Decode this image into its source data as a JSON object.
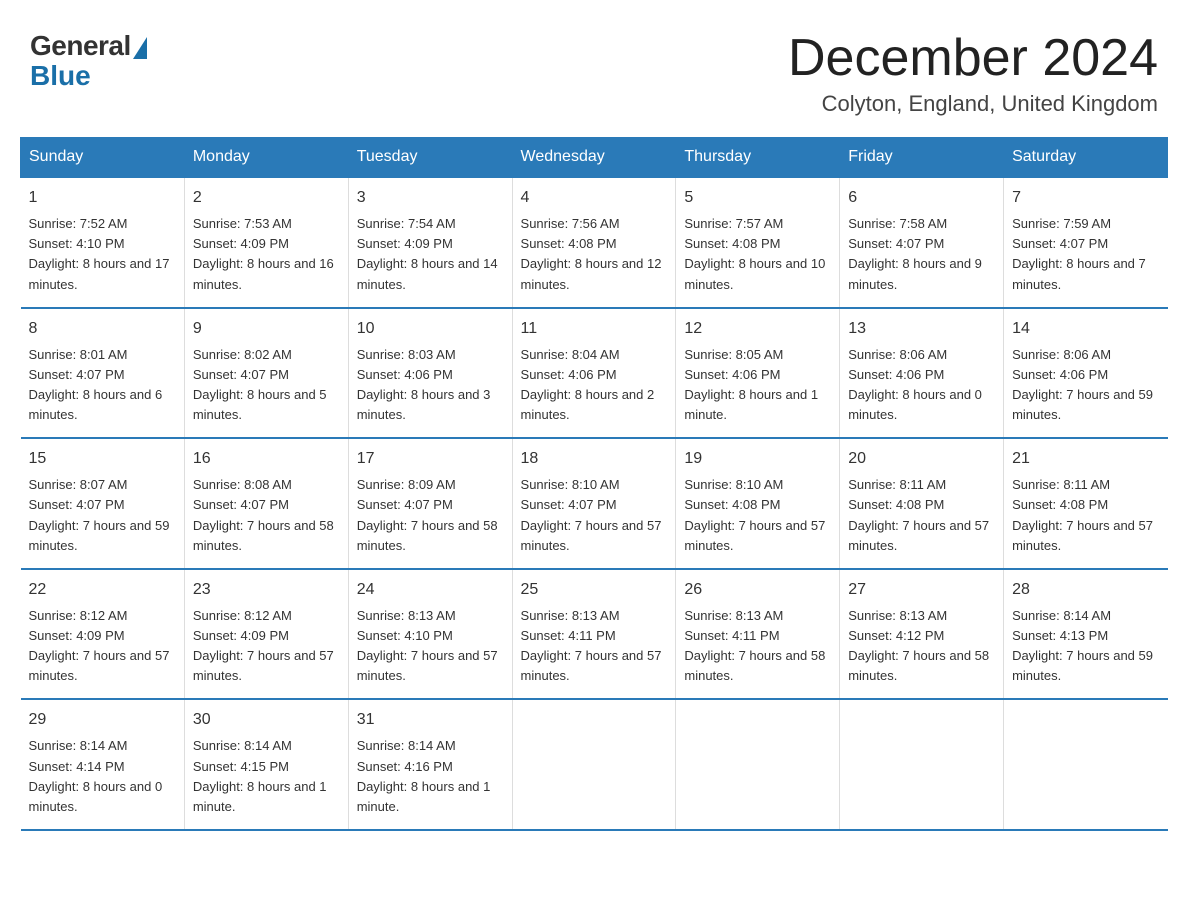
{
  "header": {
    "logo_general": "General",
    "logo_blue": "Blue",
    "title": "December 2024",
    "location": "Colyton, England, United Kingdom"
  },
  "days_of_week": [
    "Sunday",
    "Monday",
    "Tuesday",
    "Wednesday",
    "Thursday",
    "Friday",
    "Saturday"
  ],
  "weeks": [
    [
      {
        "num": "1",
        "sunrise": "7:52 AM",
        "sunset": "4:10 PM",
        "daylight": "8 hours and 17 minutes."
      },
      {
        "num": "2",
        "sunrise": "7:53 AM",
        "sunset": "4:09 PM",
        "daylight": "8 hours and 16 minutes."
      },
      {
        "num": "3",
        "sunrise": "7:54 AM",
        "sunset": "4:09 PM",
        "daylight": "8 hours and 14 minutes."
      },
      {
        "num": "4",
        "sunrise": "7:56 AM",
        "sunset": "4:08 PM",
        "daylight": "8 hours and 12 minutes."
      },
      {
        "num": "5",
        "sunrise": "7:57 AM",
        "sunset": "4:08 PM",
        "daylight": "8 hours and 10 minutes."
      },
      {
        "num": "6",
        "sunrise": "7:58 AM",
        "sunset": "4:07 PM",
        "daylight": "8 hours and 9 minutes."
      },
      {
        "num": "7",
        "sunrise": "7:59 AM",
        "sunset": "4:07 PM",
        "daylight": "8 hours and 7 minutes."
      }
    ],
    [
      {
        "num": "8",
        "sunrise": "8:01 AM",
        "sunset": "4:07 PM",
        "daylight": "8 hours and 6 minutes."
      },
      {
        "num": "9",
        "sunrise": "8:02 AM",
        "sunset": "4:07 PM",
        "daylight": "8 hours and 5 minutes."
      },
      {
        "num": "10",
        "sunrise": "8:03 AM",
        "sunset": "4:06 PM",
        "daylight": "8 hours and 3 minutes."
      },
      {
        "num": "11",
        "sunrise": "8:04 AM",
        "sunset": "4:06 PM",
        "daylight": "8 hours and 2 minutes."
      },
      {
        "num": "12",
        "sunrise": "8:05 AM",
        "sunset": "4:06 PM",
        "daylight": "8 hours and 1 minute."
      },
      {
        "num": "13",
        "sunrise": "8:06 AM",
        "sunset": "4:06 PM",
        "daylight": "8 hours and 0 minutes."
      },
      {
        "num": "14",
        "sunrise": "8:06 AM",
        "sunset": "4:06 PM",
        "daylight": "7 hours and 59 minutes."
      }
    ],
    [
      {
        "num": "15",
        "sunrise": "8:07 AM",
        "sunset": "4:07 PM",
        "daylight": "7 hours and 59 minutes."
      },
      {
        "num": "16",
        "sunrise": "8:08 AM",
        "sunset": "4:07 PM",
        "daylight": "7 hours and 58 minutes."
      },
      {
        "num": "17",
        "sunrise": "8:09 AM",
        "sunset": "4:07 PM",
        "daylight": "7 hours and 58 minutes."
      },
      {
        "num": "18",
        "sunrise": "8:10 AM",
        "sunset": "4:07 PM",
        "daylight": "7 hours and 57 minutes."
      },
      {
        "num": "19",
        "sunrise": "8:10 AM",
        "sunset": "4:08 PM",
        "daylight": "7 hours and 57 minutes."
      },
      {
        "num": "20",
        "sunrise": "8:11 AM",
        "sunset": "4:08 PM",
        "daylight": "7 hours and 57 minutes."
      },
      {
        "num": "21",
        "sunrise": "8:11 AM",
        "sunset": "4:08 PM",
        "daylight": "7 hours and 57 minutes."
      }
    ],
    [
      {
        "num": "22",
        "sunrise": "8:12 AM",
        "sunset": "4:09 PM",
        "daylight": "7 hours and 57 minutes."
      },
      {
        "num": "23",
        "sunrise": "8:12 AM",
        "sunset": "4:09 PM",
        "daylight": "7 hours and 57 minutes."
      },
      {
        "num": "24",
        "sunrise": "8:13 AM",
        "sunset": "4:10 PM",
        "daylight": "7 hours and 57 minutes."
      },
      {
        "num": "25",
        "sunrise": "8:13 AM",
        "sunset": "4:11 PM",
        "daylight": "7 hours and 57 minutes."
      },
      {
        "num": "26",
        "sunrise": "8:13 AM",
        "sunset": "4:11 PM",
        "daylight": "7 hours and 58 minutes."
      },
      {
        "num": "27",
        "sunrise": "8:13 AM",
        "sunset": "4:12 PM",
        "daylight": "7 hours and 58 minutes."
      },
      {
        "num": "28",
        "sunrise": "8:14 AM",
        "sunset": "4:13 PM",
        "daylight": "7 hours and 59 minutes."
      }
    ],
    [
      {
        "num": "29",
        "sunrise": "8:14 AM",
        "sunset": "4:14 PM",
        "daylight": "8 hours and 0 minutes."
      },
      {
        "num": "30",
        "sunrise": "8:14 AM",
        "sunset": "4:15 PM",
        "daylight": "8 hours and 1 minute."
      },
      {
        "num": "31",
        "sunrise": "8:14 AM",
        "sunset": "4:16 PM",
        "daylight": "8 hours and 1 minute."
      },
      null,
      null,
      null,
      null
    ]
  ]
}
